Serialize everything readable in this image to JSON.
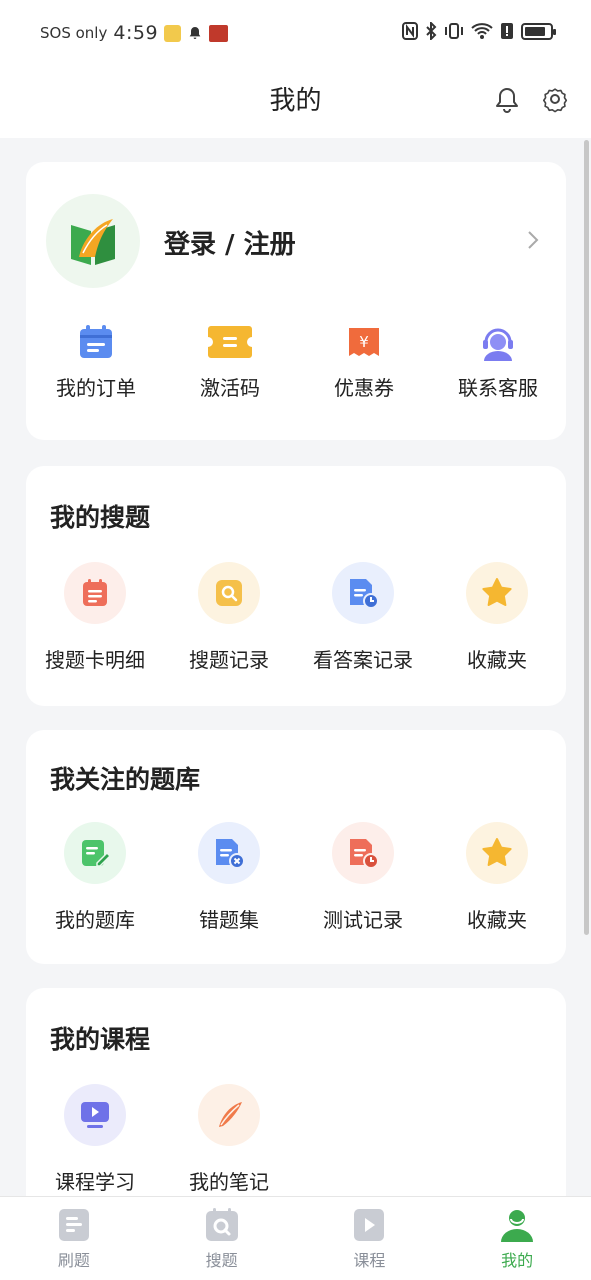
{
  "status_bar": {
    "carrier": "SOS only",
    "time": "4:59",
    "battery_level": 0.85
  },
  "header": {
    "title": "我的",
    "icons": [
      "bell-icon",
      "settings-gear-icon"
    ]
  },
  "profile": {
    "login_label": "登录 / 注册",
    "quick_actions": [
      {
        "label": "我的订单",
        "icon": "order-calendar-icon",
        "color": "#5b8cf0"
      },
      {
        "label": "激活码",
        "icon": "ticket-icon",
        "color": "#f5b731"
      },
      {
        "label": "优惠券",
        "icon": "coupon-yen-icon",
        "color": "#f06b3c"
      },
      {
        "label": "联系客服",
        "icon": "customer-service-icon",
        "color": "#7b7cf0"
      }
    ]
  },
  "my_search": {
    "title": "我的搜题",
    "items": [
      {
        "label": "搜题卡明细",
        "icon": "list-card-icon",
        "color": "#ee6e5a",
        "bg": "#fdeeea"
      },
      {
        "label": "搜题记录",
        "icon": "search-record-icon",
        "color": "#f5b731",
        "bg": "#fdf3e0"
      },
      {
        "label": "看答案记录",
        "icon": "answer-record-icon",
        "color": "#5b8cf0",
        "bg": "#e9effd"
      },
      {
        "label": "收藏夹",
        "icon": "star-icon",
        "color": "#f5b731",
        "bg": "#fdf3e0"
      }
    ]
  },
  "followed_banks": {
    "title": "我关注的题库",
    "items": [
      {
        "label": "我的题库",
        "icon": "edit-bank-icon",
        "color": "#4cc46a",
        "bg": "#e8f8ec"
      },
      {
        "label": "错题集",
        "icon": "wrong-questions-icon",
        "color": "#5b8cf0",
        "bg": "#e9effd"
      },
      {
        "label": "测试记录",
        "icon": "test-record-icon",
        "color": "#ee6e5a",
        "bg": "#fdeeea"
      },
      {
        "label": "收藏夹",
        "icon": "star-icon",
        "color": "#f5b731",
        "bg": "#fdf3e0"
      }
    ]
  },
  "my_courses": {
    "title": "我的课程",
    "items": [
      {
        "label": "课程学习",
        "icon": "video-play-icon",
        "color": "#6f72e8",
        "bg": "#ebebfb"
      },
      {
        "label": "我的笔记",
        "icon": "feather-note-icon",
        "color": "#f07a4a",
        "bg": "#fdf0e6"
      }
    ]
  },
  "tabbar": {
    "tabs": [
      {
        "label": "刷题",
        "icon": "practice-doc-icon",
        "active": false
      },
      {
        "label": "搜题",
        "icon": "search-tab-icon",
        "active": false
      },
      {
        "label": "课程",
        "icon": "course-play-icon",
        "active": false
      },
      {
        "label": "我的",
        "icon": "user-profile-icon",
        "active": true
      }
    ],
    "active_color": "#3caa4e",
    "inactive_color": "#8a8f99"
  }
}
